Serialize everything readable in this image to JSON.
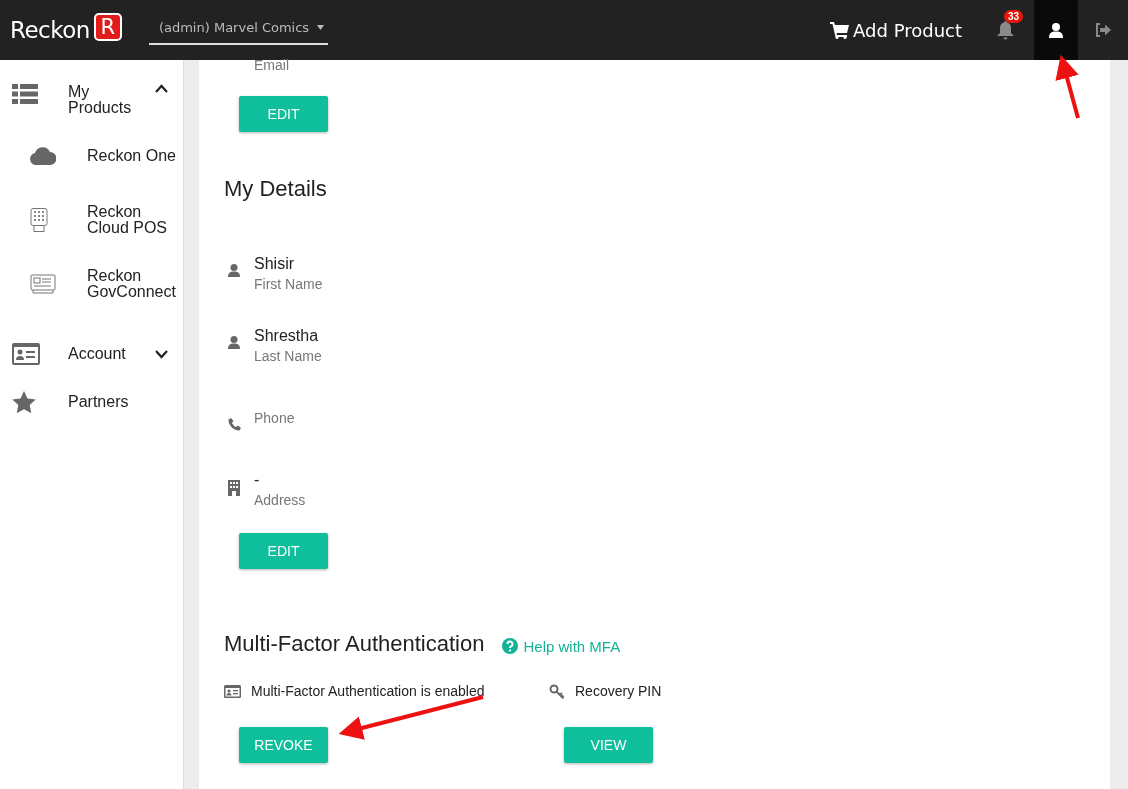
{
  "header": {
    "logo_text": "Reckon",
    "logo_mark": "R",
    "account_selector": "(admin) Marvel Comics",
    "add_product": "Add Product",
    "notification_count": "33"
  },
  "sidebar": {
    "items": [
      {
        "label": "My Products",
        "kind": "group",
        "expanded": true,
        "children": [
          {
            "label": "Reckon One"
          },
          {
            "label": "Reckon Cloud POS"
          },
          {
            "label": "Reckon GovConnect"
          }
        ]
      },
      {
        "label": "Account",
        "kind": "group",
        "expanded": false
      },
      {
        "label": "Partners",
        "kind": "link"
      }
    ]
  },
  "email_section": {
    "label": "Email",
    "edit_button": "EDIT"
  },
  "my_details": {
    "title": "My Details",
    "fields": [
      {
        "value": "Shisir",
        "label": "First Name"
      },
      {
        "value": "Shrestha",
        "label": "Last Name"
      },
      {
        "label": "Phone"
      },
      {
        "value": "-",
        "label": "Address"
      }
    ],
    "edit_button": "EDIT"
  },
  "mfa": {
    "title": "Multi-Factor Authentication",
    "help_link": "Help with MFA",
    "status": "Multi-Factor Authentication is enabled",
    "recovery_label": "Recovery PIN",
    "revoke_button": "REVOKE",
    "view_button": "VIEW"
  }
}
